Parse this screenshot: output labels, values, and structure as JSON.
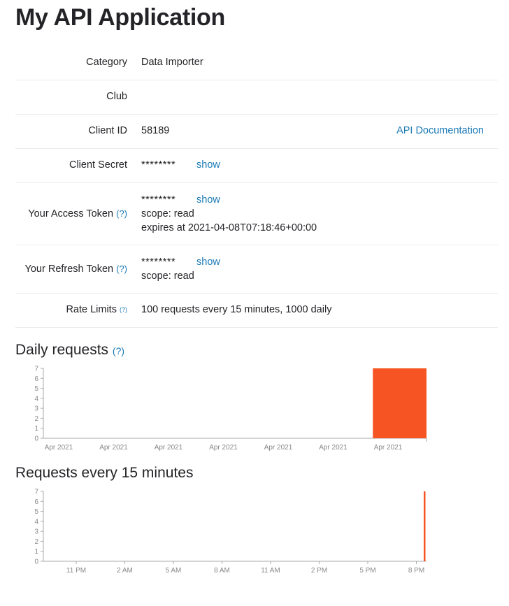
{
  "page": {
    "title": "My API Application"
  },
  "details": {
    "category": {
      "label": "Category",
      "value": "Data Importer"
    },
    "club": {
      "label": "Club",
      "value": ""
    },
    "client_id": {
      "label": "Client ID",
      "value": "58189",
      "doc_link": "API Documentation"
    },
    "client_secret": {
      "label": "Client Secret",
      "value": "********",
      "show": "show"
    },
    "access_token": {
      "label": "Your Access Token",
      "help": "(?)",
      "value": "********",
      "show": "show",
      "scope": "scope: read",
      "expires": "expires at 2021-04-08T07:18:46+00:00"
    },
    "refresh_token": {
      "label": "Your Refresh Token",
      "help": "(?)",
      "value": "********",
      "show": "show",
      "scope": "scope: read"
    },
    "rate_limits": {
      "label": "Rate Limits",
      "help": "(?)",
      "value": "100 requests every 15 minutes, 1000 daily"
    }
  },
  "colors": {
    "accent": "#fc5200",
    "bar": "#f75424",
    "link": "#1a7ab5"
  },
  "chart_data": [
    {
      "type": "bar",
      "title": "Daily requests",
      "title_help": "(?)",
      "ylim": [
        0,
        7
      ],
      "yticks": [
        0,
        1,
        2,
        3,
        4,
        5,
        6,
        7
      ],
      "xtick_labels": [
        "Apr 2021",
        "Apr 2021",
        "Apr 2021",
        "Apr 2021",
        "Apr 2021",
        "Apr 2021",
        "Apr 2021"
      ],
      "values": [
        0,
        0,
        0,
        0,
        0,
        0,
        7
      ]
    },
    {
      "type": "bar",
      "title": "Requests every 15 minutes",
      "ylim": [
        0,
        7
      ],
      "yticks": [
        0,
        1,
        2,
        3,
        4,
        5,
        6,
        7
      ],
      "xtick_labels": [
        "11 PM",
        "2 AM",
        "5 AM",
        "8 AM",
        "11 AM",
        "2 PM",
        "5 PM",
        "8 PM"
      ],
      "values_note_last_bin": 7,
      "last_bin_value": 7
    }
  ]
}
